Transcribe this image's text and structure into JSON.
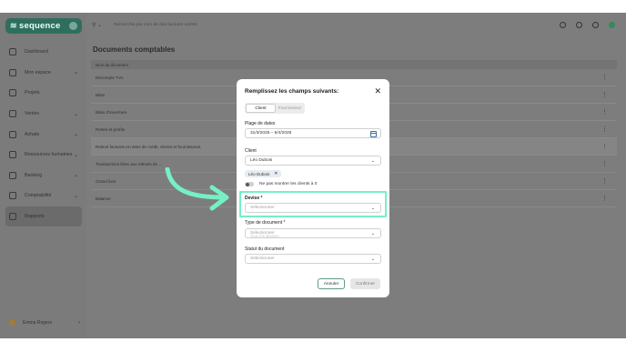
{
  "brand": {
    "name": "sequence"
  },
  "sidebar": {
    "items": [
      {
        "label": "Dashboard",
        "icon": "dashboard-icon",
        "has_chevron": false
      },
      {
        "label": "Mon espace",
        "icon": "person-icon",
        "has_chevron": true
      },
      {
        "label": "Projets",
        "icon": "projects-icon",
        "has_chevron": false
      },
      {
        "label": "Ventes",
        "icon": "sales-icon",
        "has_chevron": true
      },
      {
        "label": "Achats",
        "icon": "purchases-icon",
        "has_chevron": true
      },
      {
        "label": "Ressources humaines",
        "icon": "hr-icon",
        "has_chevron": true
      },
      {
        "label": "Banking",
        "icon": "bank-icon",
        "has_chevron": true
      },
      {
        "label": "Comptabilité",
        "icon": "accounting-icon",
        "has_chevron": true
      },
      {
        "label": "Rapports",
        "icon": "reports-icon",
        "has_chevron": false,
        "active": true
      }
    ],
    "user": {
      "name": "Emma Rogers"
    }
  },
  "topbar": {
    "search_placeholder": "Recherche par nom de des factures ventes"
  },
  "main": {
    "title": "Documents comptables",
    "table_header": "Nom du document",
    "rows": [
      "Décompte TVA",
      "Bilan",
      "Bilan d'ouverture",
      "Pertes et profits",
      "Relevé factures et notes de crédit, clients et fournisseurs",
      "Transactions liées aux relevés de ...",
      "Grand livre",
      "Balance"
    ],
    "highlighted_row_index": 4
  },
  "modal": {
    "title": "Remplissez les champs suivants:",
    "tabs": [
      {
        "label": "Client",
        "active": true
      },
      {
        "label": "Fournisseur",
        "active": false
      }
    ],
    "date_range_label": "Plage de dates",
    "date_range_value": "31/3/2025 – 6/4/2025",
    "client_label": "Client",
    "client_value": "Léo Dubois",
    "client_chip": "Léo Dubois",
    "toggle_label": "Ne pas montrer les clients à 0",
    "currency_label": "Devise *",
    "currency_placeholder": "Sélectionner",
    "doc_type_label": "Type de document *",
    "doc_type_placeholder": "Sélectionner",
    "doc_type_overlap_text": "Tous les devises",
    "doc_status_label": "Statut du document",
    "doc_status_placeholder": "Sélectionner",
    "cancel_label": "Annuler",
    "confirm_label": "Confirmer"
  },
  "colors": {
    "brand_green": "#2f6e5f",
    "highlight_mint": "#75f0c5",
    "overlay_gray": "#7d7d7d"
  }
}
